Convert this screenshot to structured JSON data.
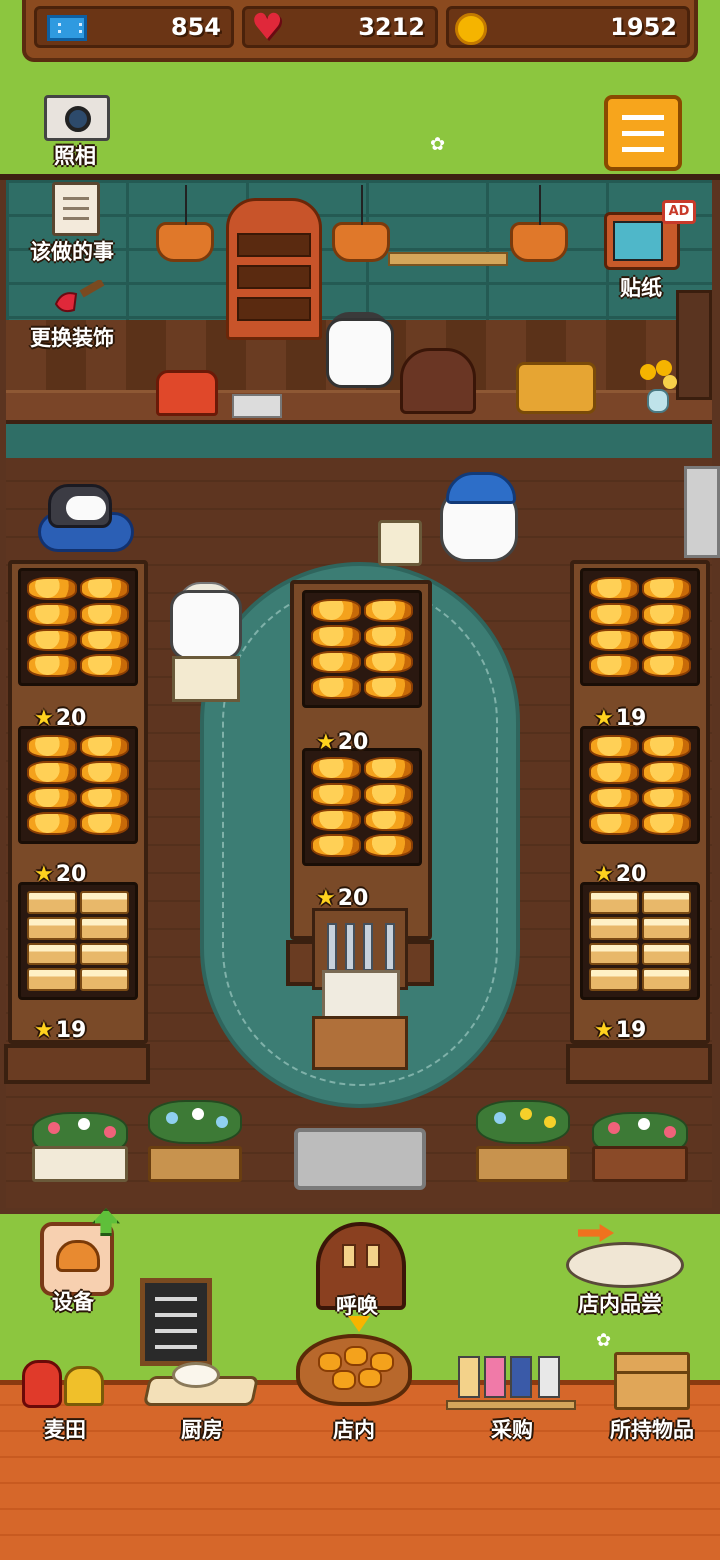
{
  "resources": {
    "tickets": "854",
    "hearts": "3212",
    "coins": "1952"
  },
  "top_actions": {
    "camera_label": "照相",
    "menu_icon": "hamburger-menu-icon"
  },
  "shop_actions": {
    "todo_label": "该做的事",
    "decorate_label": "更换装饰",
    "sticker_label": "贴纸",
    "ad_badge": "AD"
  },
  "shelves": {
    "left": [
      {
        "item": "bun",
        "stars": "20"
      },
      {
        "item": "bun",
        "stars": "20"
      },
      {
        "item": "toast",
        "stars": "19"
      }
    ],
    "center": [
      {
        "item": "bun",
        "stars": "20"
      },
      {
        "item": "bun",
        "stars": "20"
      }
    ],
    "right": [
      {
        "item": "bun",
        "stars": "19"
      },
      {
        "item": "bun",
        "stars": "20"
      },
      {
        "item": "toast",
        "stars": "19"
      }
    ]
  },
  "bottom_actions": {
    "equipment_label": "设备",
    "summon_label": "呼唤",
    "tasting_label": "店内品尝"
  },
  "nav": [
    {
      "label": "麦田",
      "icon": "wheat-field-icon"
    },
    {
      "label": "厨房",
      "icon": "kitchen-icon"
    },
    {
      "label": "店内",
      "icon": "shop-icon"
    },
    {
      "label": "采购",
      "icon": "purchase-icon"
    },
    {
      "label": "所持物品",
      "icon": "inventory-box-icon"
    }
  ],
  "colors": {
    "grass": "#8cc63f",
    "wood_bar": "#8b4a1f",
    "accent_orange": "#f7a51c",
    "wall_teal": "#2f6e66"
  }
}
